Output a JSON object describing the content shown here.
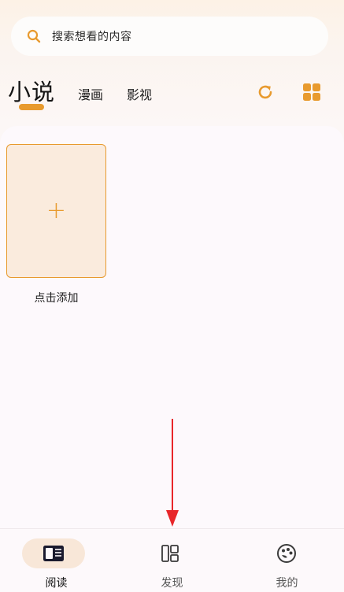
{
  "search": {
    "placeholder": "搜索想看的内容"
  },
  "tabs": {
    "items": [
      {
        "label": "小说",
        "active": true
      },
      {
        "label": "漫画",
        "active": false
      },
      {
        "label": "影视",
        "active": false
      }
    ]
  },
  "toolbar": {
    "refresh_icon": "refresh-icon",
    "layout_icon": "grid-icon"
  },
  "library": {
    "add_label": "点击添加",
    "add_glyph": "+"
  },
  "bottom_nav": {
    "items": [
      {
        "label": "阅读",
        "icon": "book-icon",
        "active": true
      },
      {
        "label": "发现",
        "icon": "layout-icon",
        "active": false
      },
      {
        "label": "我的",
        "icon": "palette-icon",
        "active": false
      }
    ]
  },
  "colors": {
    "accent": "#e89a2e",
    "arrow": "#e8262a"
  }
}
